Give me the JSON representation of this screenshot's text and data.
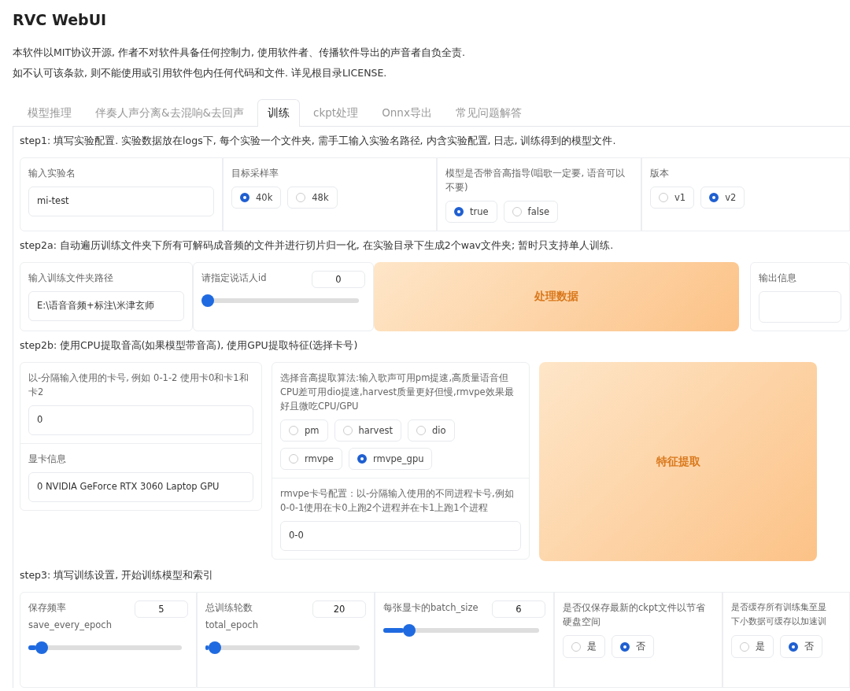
{
  "app_title": "RVC WebUI",
  "notice": [
    "本软件以MIT协议开源, 作者不对软件具备任何控制力, 使用软件者、传播软件导出的声音者自负全责.",
    "如不认可该条款, 则不能使用或引用软件包内任何代码和文件. 详见根目录LICENSE."
  ],
  "tabs": [
    {
      "label": "模型推理",
      "selected": false
    },
    {
      "label": "伴奏人声分离&去混响&去回声",
      "selected": false
    },
    {
      "label": "训练",
      "selected": true
    },
    {
      "label": "ckpt处理",
      "selected": false
    },
    {
      "label": "Onnx导出",
      "selected": false
    },
    {
      "label": "常见问题解答",
      "selected": false
    }
  ],
  "sections": [
    {
      "heading": "step1: 填写实验配置. 实验数据放在logs下, 每个实验一个文件夹, 需手工输入实验名路径, 内含实验配置, 日志, 训练得到的模型文件.",
      "blocks": [
        {
          "kind": "text",
          "label": "输入实验名",
          "value": "mi-test"
        },
        {
          "kind": "radio",
          "label": "目标采样率",
          "options": [
            {
              "label": "40k",
              "selected": true
            },
            {
              "label": "48k",
              "selected": false
            }
          ]
        },
        {
          "kind": "radio",
          "label": "模型是否带音高指导(唱歌一定要, 语音可以不要)",
          "options": [
            {
              "label": "true",
              "selected": true
            },
            {
              "label": "false",
              "selected": false
            }
          ]
        },
        {
          "kind": "radio",
          "label": "版本",
          "options": [
            {
              "label": "v1",
              "selected": false
            },
            {
              "label": "v2",
              "selected": true
            }
          ]
        }
      ]
    },
    {
      "heading": "step2a: 自动遍历训练文件夹下所有可解码成音频的文件并进行切片归一化, 在实验目录下生成2个wav文件夹; 暂时只支持单人训练.",
      "blocks": [
        {
          "kind": "text",
          "label": "输入训练文件夹路径",
          "value": "E:\\语音音频+标注\\米津玄师"
        },
        {
          "kind": "slider",
          "label": "请指定说话人id",
          "value": "0",
          "level": 0
        },
        {
          "kind": "button",
          "label": "处理数据"
        },
        {
          "kind": "output",
          "label": "输出信息"
        }
      ]
    },
    {
      "heading": "step2b: 使用CPU提取音高(如果模型带音高), 使用GPU提取特征(选择卡号)",
      "blocks": [
        {
          "kind": "column",
          "children": [
            {
              "kind": "text",
              "label": "以-分隔输入使用的卡号, 例如 0-1-2 使用卡0和卡1和卡2",
              "value": "0"
            },
            {
              "kind": "text",
              "label": "显卡信息",
              "value": "0 NVIDIA GeForce RTX 3060 Laptop GPU"
            }
          ]
        },
        {
          "kind": "column",
          "children": [
            {
              "kind": "radio",
              "label": "选择音高提取算法:输入歌声可用pm提速,高质量语音但CPU差可用dio提速,harvest质量更好但慢,rmvpe效果最好且微吃CPU/GPU",
              "options": [
                {
                  "label": "pm",
                  "selected": false
                },
                {
                  "label": "harvest",
                  "selected": false
                },
                {
                  "label": "dio",
                  "selected": false
                },
                {
                  "label": "rmvpe",
                  "selected": false
                },
                {
                  "label": "rmvpe_gpu",
                  "selected": true
                }
              ]
            },
            {
              "kind": "text",
              "label": "rmvpe卡号配置：以-分隔输入使用的不同进程卡号,例如0-0-1使用在卡0上跑2个进程并在卡1上跑1个进程",
              "value": "0-0"
            }
          ]
        },
        {
          "kind": "button",
          "label": "特征提取"
        }
      ]
    },
    {
      "heading": "step3: 填写训练设置, 开始训练模型和索引",
      "blocks": [
        {
          "kind": "slider",
          "label": "保存频率",
          "sublabel": "save_every_epoch",
          "value": "5",
          "level": 0.05
        },
        {
          "kind": "slider",
          "label": "总训练轮数",
          "sublabel": "total_epoch",
          "value": "20",
          "level": 0.02
        },
        {
          "kind": "slider",
          "label": "每张显卡的batch_size",
          "value": "6",
          "level": 0.13
        },
        {
          "kind": "radio",
          "label": "是否仅保存最新的ckpt文件以节省硬盘空间",
          "options": [
            {
              "label": "是",
              "selected": false
            },
            {
              "label": "否",
              "selected": true
            }
          ]
        },
        {
          "kind": "radio",
          "label_lines": [
            "是否缓存所有训练集至显",
            "下小数据可缓存以加速训"
          ],
          "options": [
            {
              "label": "是",
              "selected": false
            },
            {
              "label": "否",
              "selected": true
            }
          ]
        }
      ]
    }
  ]
}
